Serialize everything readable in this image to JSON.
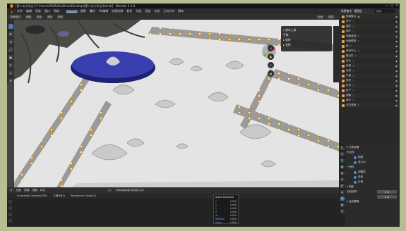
{
  "window": {
    "title": "[第二次大作业] C:\\Users\\YOUR\\OneDrive\\Desktop\\[第二次大作业(blend)] - Blender 4.1.0",
    "controls": [
      "—",
      "□",
      "✕"
    ]
  },
  "menu": {
    "items": [
      "文件",
      "编辑",
      "渲染",
      "窗口",
      "帮助"
    ],
    "workspaces": [
      "Layout",
      "建模",
      "雕刻",
      "UV编辑",
      "纹理绘制",
      "着色",
      "动画",
      "渲染",
      "合成",
      "几何节点",
      "脚本"
    ],
    "active_workspace": "Layout",
    "right": [
      "Scene",
      "ViewLayer"
    ]
  },
  "viewport_header": {
    "items": [
      "物体模式",
      "视图",
      "选择",
      "添加",
      "物体",
      "全局",
      "选项"
    ]
  },
  "toolbar": {
    "tools": [
      "↖",
      "✥",
      "⟲",
      "⤢",
      "▣",
      "✎",
      "∠",
      "⊕"
    ]
  },
  "npanel": {
    "rows": [
      "▾ 基本工具",
      "  平移",
      "▸ 旋转",
      "▸ 变换"
    ]
  },
  "nav_buttons": [
    "⊙",
    "✋",
    "🎥",
    "▦"
  ],
  "outliner": {
    "header": [
      "场景集合",
      "视图层"
    ],
    "search_placeholder": "搜索",
    "rows": [
      {
        "label": "场景集合",
        "icon": "▣"
      },
      {
        "label": "亭子",
        "icon": "▽"
      },
      {
        "label": "围栏",
        "icon": "▽"
      },
      {
        "label": "荷叶",
        "icon": "▽"
      },
      {
        "label": "地面装饰",
        "icon": "▽"
      },
      {
        "label": "地板模型",
        "icon": "▽"
      },
      {
        "label": "树",
        "icon": "▽"
      },
      {
        "label": "荷花叶片",
        "icon": "▽"
      },
      {
        "label": "路灯灯",
        "icon": "▽"
      },
      {
        "label": "石头",
        "icon": "▽"
      },
      {
        "label": "树枝",
        "icon": "▽"
      },
      {
        "label": "石桥",
        "icon": "▽"
      },
      {
        "label": "平面",
        "icon": "▽"
      },
      {
        "label": "莲花",
        "icon": "▽"
      },
      {
        "label": "栏杆",
        "icon": "▽"
      },
      {
        "label": "柱子",
        "icon": "▽"
      },
      {
        "label": "围墙",
        "icon": "▽"
      },
      {
        "label": "荷叶",
        "icon": "▽"
      },
      {
        "label": "天空背景",
        "icon": "▽"
      }
    ]
  },
  "properties": {
    "tabs": [
      "🔧",
      "📷",
      "🌐",
      "▦",
      "◉",
      "⚙",
      "🔗",
      "◈",
      "✦",
      "▣",
      "⊕"
    ],
    "rows": [
      {
        "label": "▾ 计算设置",
        "type": "section"
      },
      {
        "label": "可见性",
        "type": "section"
      },
      {
        "label": "视图",
        "check": "✓",
        "type": "check"
      },
      {
        "label": "显示为",
        "check": "✓",
        "type": "check"
      },
      {
        "label": "一致性",
        "type": "section"
      },
      {
        "label": "视图层",
        "check": "✓",
        "type": "check"
      },
      {
        "label": "投影",
        "check": "✓",
        "type": "check"
      },
      {
        "label": "实例",
        "check": "✓",
        "type": "check"
      },
      {
        "label": "▾ 阴影",
        "type": "section"
      },
      {
        "label": "光线追踪",
        "value": "0 m",
        "type": "field"
      },
      {
        "label": "",
        "value": "0 m",
        "type": "field"
      },
      {
        "label": "▸ 运动模糊",
        "type": "section"
      }
    ]
  },
  "timeline": {
    "header": [
      "▾",
      "回放",
      "抠像",
      "视图",
      "标记"
    ],
    "strip": [
      "Animated Cylinder(Fill1)",
      "平滑(Mt1)",
      "Procedural Ghost(1)"
    ],
    "frame": "1",
    "mode": "Procedural Ghost 1.0",
    "values": [
      "0",
      "1",
      "250"
    ]
  },
  "popup": {
    "title": "Active Keyframe",
    "rows": [
      [
        "F",
        "0.000"
      ],
      [
        "X",
        "0.000"
      ],
      [
        "Y",
        "0.000"
      ],
      [
        "Z",
        "0.000"
      ],
      [
        "W",
        "0.000"
      ],
      [
        "Rotation",
        "0.000"
      ],
      [
        "Scale",
        "1.000"
      ]
    ]
  },
  "colors": {
    "accent": "#4772b3",
    "orange": "#e87d0d",
    "bg": "#1d1d1d",
    "viewport": "#e2e2e2",
    "platform": "#2a2f8a"
  }
}
